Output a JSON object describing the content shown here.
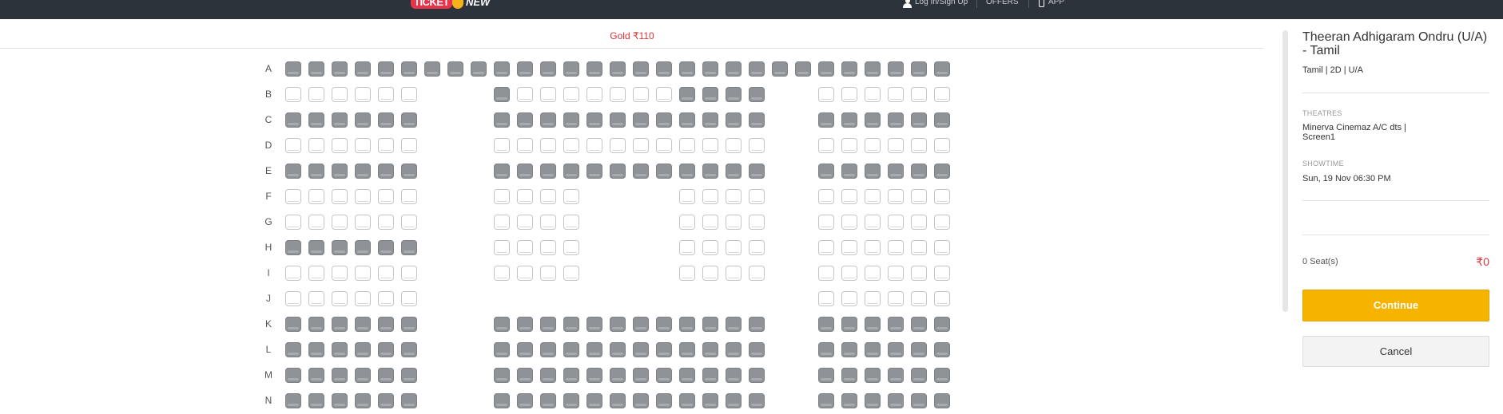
{
  "header": {
    "logo_left": "TICKET",
    "logo_right": "NEW",
    "login_label": "Log In/Sign Up",
    "offers_label": "OFFERS",
    "app_label": "APP"
  },
  "seat_map": {
    "category_label": "Gold ₹110",
    "rows": [
      {
        "label": "A",
        "blocks": [
          [
            1,
            1,
            1,
            1,
            1,
            1,
            1,
            1,
            1,
            1,
            1,
            1,
            1,
            1,
            1,
            1,
            1,
            1,
            1,
            1,
            1,
            1,
            1,
            1,
            1,
            1,
            1,
            1,
            1
          ]
        ]
      },
      {
        "label": "B",
        "blocks": [
          [
            0,
            0,
            0,
            0,
            0,
            0
          ],
          [
            1,
            0,
            0,
            0,
            0,
            0,
            0,
            0,
            1,
            1,
            1,
            1
          ],
          [
            0,
            0,
            0,
            0,
            0,
            0
          ]
        ]
      },
      {
        "label": "C",
        "blocks": [
          [
            1,
            1,
            1,
            1,
            1,
            1
          ],
          [
            1,
            1,
            1,
            1,
            1,
            1,
            1,
            1,
            1,
            1,
            1,
            1
          ],
          [
            1,
            1,
            1,
            1,
            1,
            1
          ]
        ]
      },
      {
        "label": "D",
        "blocks": [
          [
            0,
            0,
            0,
            0,
            0,
            0
          ],
          [
            0,
            0,
            0,
            0,
            0,
            0,
            0,
            0,
            0,
            0,
            0,
            0
          ],
          [
            0,
            0,
            0,
            0,
            0,
            0
          ]
        ]
      },
      {
        "label": "E",
        "blocks": [
          [
            1,
            1,
            1,
            1,
            1,
            1
          ],
          [
            1,
            1,
            1,
            1,
            1,
            1,
            1,
            1,
            1,
            1,
            1,
            1
          ],
          [
            1,
            1,
            1,
            1,
            1,
            1
          ]
        ]
      },
      {
        "label": "F",
        "blocks": [
          [
            0,
            0,
            0,
            0,
            0,
            0
          ],
          [
            0,
            0,
            0,
            0
          ],
          [
            0,
            0,
            0,
            0
          ],
          [
            0,
            0,
            0,
            0,
            0,
            0
          ]
        ]
      },
      {
        "label": "G",
        "blocks": [
          [
            0,
            0,
            0,
            0,
            0,
            0
          ],
          [
            0,
            0,
            0,
            0
          ],
          [
            0,
            0,
            0,
            0
          ],
          [
            0,
            0,
            0,
            0,
            0,
            0
          ]
        ]
      },
      {
        "label": "H",
        "blocks": [
          [
            1,
            1,
            1,
            1,
            1,
            1
          ],
          [
            0,
            0,
            0,
            0
          ],
          [
            0,
            0,
            0,
            0
          ],
          [
            0,
            0,
            0,
            0,
            0,
            0
          ]
        ]
      },
      {
        "label": "I",
        "blocks": [
          [
            0,
            0,
            0,
            0,
            0,
            0
          ],
          [
            0,
            0,
            0,
            0
          ],
          [
            0,
            0,
            0,
            0
          ],
          [
            0,
            0,
            0,
            0,
            0,
            0
          ]
        ]
      },
      {
        "label": "J",
        "blocks": [
          [
            0,
            0,
            0,
            0,
            0,
            0
          ],
          [
            0,
            0,
            0,
            0,
            0,
            0
          ]
        ]
      },
      {
        "label": "K",
        "blocks": [
          [
            1,
            1,
            1,
            1,
            1,
            1
          ],
          [
            1,
            1,
            1,
            1,
            1,
            1,
            1,
            1,
            1,
            1,
            1,
            1
          ],
          [
            1,
            1,
            1,
            1,
            1,
            1
          ]
        ]
      },
      {
        "label": "L",
        "blocks": [
          [
            1,
            1,
            1,
            1,
            1,
            1
          ],
          [
            1,
            1,
            1,
            1,
            1,
            1,
            1,
            1,
            1,
            1,
            1,
            1
          ],
          [
            1,
            1,
            1,
            1,
            1,
            1
          ]
        ]
      },
      {
        "label": "M",
        "blocks": [
          [
            1,
            1,
            1,
            1,
            1,
            1
          ],
          [
            1,
            1,
            1,
            1,
            1,
            1,
            1,
            1,
            1,
            1,
            1,
            1
          ],
          [
            1,
            1,
            1,
            1,
            1,
            1
          ]
        ]
      },
      {
        "label": "N",
        "blocks": [
          [
            1,
            1,
            1,
            1,
            1,
            1
          ],
          [
            1,
            1,
            1,
            1,
            1,
            1,
            1,
            1,
            1,
            1,
            1,
            1
          ],
          [
            1,
            1,
            1,
            1,
            1,
            1
          ]
        ]
      }
    ]
  },
  "summary": {
    "movie_title": "Theeran Adhigaram Ondru (U/A) - Tamil",
    "movie_meta": "Tamil | 2D | U/A",
    "theatres_label": "THEATRES",
    "theatre_value": "Minerva Cinemaz A/C dts | Screen1",
    "showtime_label": "SHOWTIME",
    "showtime_value": "Sun, 19 Nov 06:30 PM",
    "seat_count": "0 Seat(s)",
    "total": "₹0",
    "continue_label": "Continue",
    "cancel_label": "Cancel"
  },
  "colors": {
    "topbar": "#2d333a",
    "accent_red": "#d9343a",
    "continue_yellow": "#f6b300",
    "sold_seat": "#8f9397",
    "free_seat_border": "#c3c6c9"
  }
}
